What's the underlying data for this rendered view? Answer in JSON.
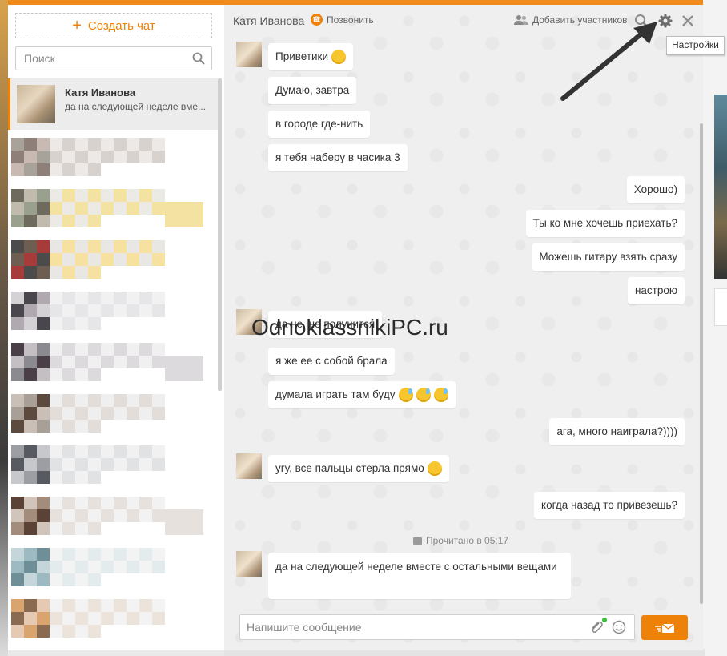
{
  "left_panel": {
    "create_chat_label": "Создать чат",
    "search_placeholder": "Поиск",
    "active_chat": {
      "name": "Катя Иванова",
      "snippet": "да на следующей неделе вме..."
    }
  },
  "header": {
    "title": "Катя Иванова",
    "call_label": "Позвонить",
    "add_participants_label": "Добавить участников",
    "settings_tooltip": "Настройки"
  },
  "messages": [
    {
      "side": "in",
      "text": "Приветики",
      "emoji": 1
    },
    {
      "side": "in",
      "text": "Думаю, завтра"
    },
    {
      "side": "in",
      "text": "в городе где-нить"
    },
    {
      "side": "in",
      "text": "я тебя наберу в часика 3"
    },
    {
      "side": "out",
      "text": "Хорошо)"
    },
    {
      "side": "out",
      "text": "Ты ко мне хочешь приехать?"
    },
    {
      "side": "out",
      "text": "Можешь гитару взять сразу"
    },
    {
      "side": "out",
      "text": "настрою"
    },
    {
      "side": "in",
      "text": "да не, не получится"
    },
    {
      "side": "in",
      "text": "я же ее с собой брала"
    },
    {
      "side": "in",
      "text": "думала играть там буду",
      "emoji": 3
    },
    {
      "side": "out",
      "text": "ага, много наиграла?))))"
    },
    {
      "side": "in",
      "text": "угу, все пальцы стерла прямо",
      "emoji": 1
    },
    {
      "side": "out",
      "text": "когда назад то привезешь?"
    },
    {
      "side": "in",
      "text": "да на следующей неделе вместе с остальными вещами"
    }
  ],
  "read_status": "Прочитано в 05:17",
  "composer": {
    "placeholder": "Напишите сообщение"
  },
  "watermark": "OdnoklassnikiPC.ru",
  "colors": {
    "accent": "#ee8208",
    "chat_bg": "#efefef",
    "bubble": "#ffffff"
  }
}
